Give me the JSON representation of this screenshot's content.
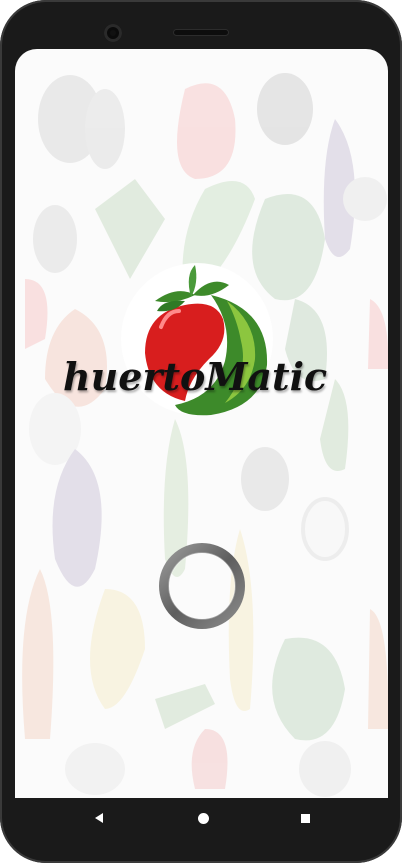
{
  "app": {
    "name": "huertoMatic"
  },
  "colors": {
    "frame": "#1a1a1a",
    "screen_bg": "#fbfbfb",
    "tomato_red": "#d81e1e",
    "leaf_green": "#3d8a2a",
    "light_green": "#8cc63f",
    "spinner_gray": "#6e6e6e"
  },
  "icons": {
    "logo": "tomato-leaf-logo",
    "loader": "loading-spinner",
    "nav_back": "back-triangle-icon",
    "nav_home": "home-circle-icon",
    "nav_recents": "recents-square-icon"
  }
}
